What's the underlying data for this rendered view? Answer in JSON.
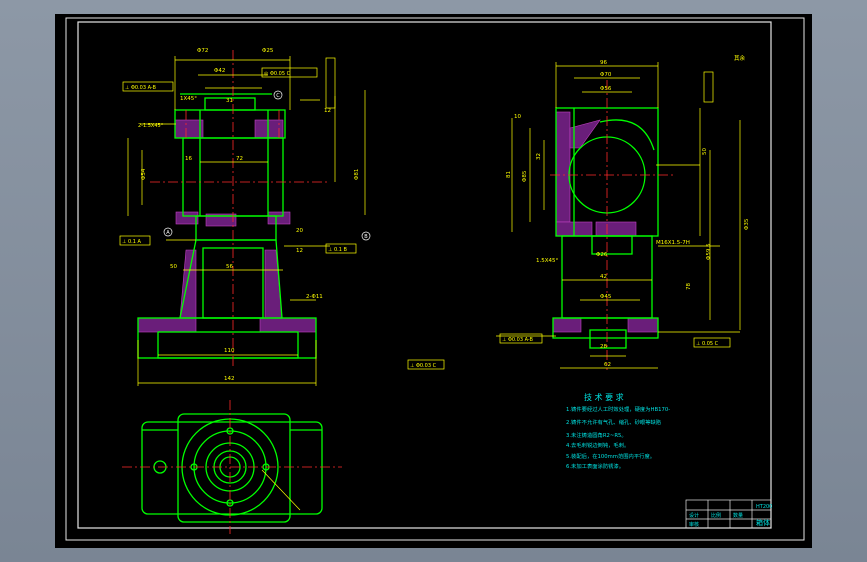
{
  "colors": {
    "background": "#000000",
    "frame": "#e6e6e6",
    "outline": "#00ff00",
    "dimension": "#ffff00",
    "centerline": "#ff2a2a",
    "hatch": "#b040c0",
    "accent": "#00e0e0",
    "white": "#ffffff"
  },
  "front_view": {
    "dims": [
      "Φ72",
      "Φ25",
      "Φ42",
      "1X45°",
      "31",
      "72",
      "16",
      "56",
      "Φ54",
      "12",
      "20",
      "Φ81",
      "12",
      "Φ5",
      "50",
      "110",
      "142",
      "2-Φ11",
      "Φ50",
      "120",
      "12"
    ],
    "callouts": [
      "A",
      "B",
      "C"
    ],
    "frames": [
      "⊥ Φ0.03 A-B",
      "⊥ 0.1 A",
      "⊥ 0.1 B",
      "◎ Φ0.05 C",
      "⊥ Φ0.03 C"
    ],
    "chamfer": "2-1.5X45°"
  },
  "side_view": {
    "dims": [
      "96",
      "Φ70",
      "Φ56",
      "10",
      "Φ85",
      "32",
      "81",
      "30",
      "50",
      "Φ26",
      "42",
      "Φ45",
      "28",
      "62",
      "12",
      "78",
      "Φ59.5",
      "Φ35",
      "M16X1.5-7H",
      "1.5X45°"
    ],
    "frames": [
      "⊥ Φ0.03 A-B",
      "⊥ 0.05 C",
      "⊥ 0.05 A",
      "⊥ Φ0.05 B",
      "⊥ Φ0.03 C"
    ],
    "roughness_note": "其余"
  },
  "tech_req": {
    "title": "技 术 要 求",
    "items": [
      "1.铸件要经过人工时效处理，硬度为HB170-",
      "2.铸件不允许有气孔、缩孔、砂眼等缺陷",
      "3.未注铸造圆角R2~R5。",
      "4.去毛刺锐边倒钝，毛刺。",
      "5.装配后，在100mm范围内平行度。",
      "6.未加工表面涂防锈漆。"
    ]
  },
  "title_block": {
    "material": "HT200",
    "part_name": "箱体",
    "cells": [
      "设计",
      "审核",
      "比例",
      "数量",
      "第1张"
    ]
  }
}
